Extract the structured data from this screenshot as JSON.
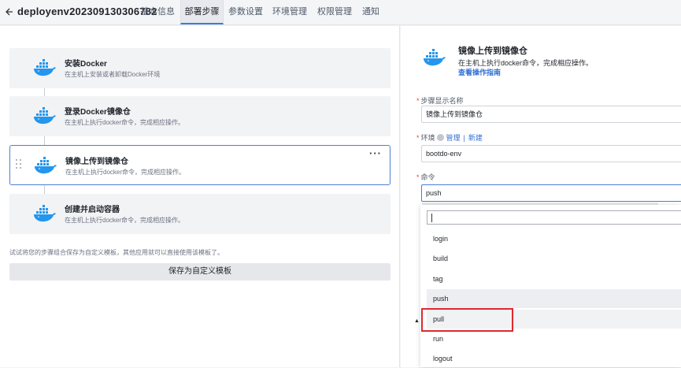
{
  "header": {
    "title": "deployenv202309130306782",
    "tabs": [
      {
        "label": "基本信息"
      },
      {
        "label": "部署步骤",
        "active": true
      },
      {
        "label": "参数设置"
      },
      {
        "label": "环境管理"
      },
      {
        "label": "权限管理"
      },
      {
        "label": "通知"
      }
    ]
  },
  "steps": [
    {
      "title": "安装Docker",
      "desc": "在主机上安装或者卸载Docker环境"
    },
    {
      "title": "登录Docker镜像仓",
      "desc": "在主机上执行docker命令，完成相应操作。"
    },
    {
      "title": "镜像上传到镜像仓",
      "desc": "在主机上执行docker命令，完成相应操作。",
      "selected": true
    },
    {
      "title": "创建并启动容器",
      "desc": "在主机上执行docker命令，完成相应操作。"
    }
  ],
  "more_label": "···",
  "template_hint": "试试将您的步骤组合保存为自定义模板，其他应用就可以直接使用该模板了。",
  "save_template_label": "保存为自定义模板",
  "detail": {
    "title": "镜像上传到镜像仓",
    "desc": "在主机上执行docker命令，完成相应操作。",
    "guide_link": "查看操作指南",
    "step_name_label": "步骤显示名称",
    "step_name_value": "镜像上传到镜像仓",
    "env_label": "环境",
    "env_manage": "管理",
    "env_new": "新建",
    "env_value": "bootdo-env",
    "command_label": "命令",
    "command_value": "push",
    "required_mark": "*"
  },
  "dropdown": {
    "search_value": "",
    "options": [
      "login",
      "build",
      "tag",
      "push",
      "pull",
      "run",
      "logout"
    ],
    "hovered": "push",
    "highlighted": "pull"
  },
  "colors": {
    "accent": "#2f6fd3",
    "selected_border": "#4a7fd6",
    "annotation_red": "#e0282e",
    "docker_blue": "#2496ed"
  },
  "icons": {
    "back": "arrow-left-icon",
    "step": "docker-whale-icon",
    "drag": "drag-handle-icon",
    "help": "help-circle-icon"
  }
}
